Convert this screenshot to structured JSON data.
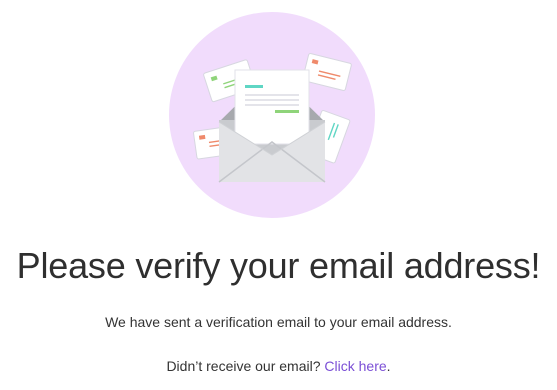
{
  "illustration": {
    "icon": "envelope-with-letters-icon",
    "circle_color": "#f1dcfc"
  },
  "heading": "Please verify your email address!",
  "message": "We have sent a verification email to your email address.",
  "resend": {
    "prompt": "Didn’t receive our email?",
    "link_label": "Click here",
    "suffix": ".",
    "link_color": "#7b4fd6"
  }
}
